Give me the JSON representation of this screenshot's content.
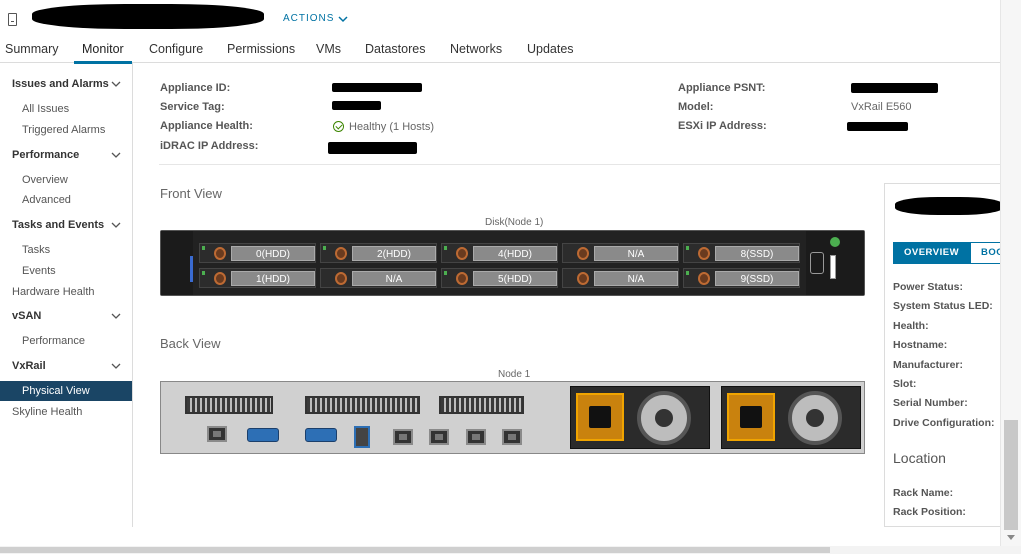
{
  "header": {
    "actions_label": "ACTIONS"
  },
  "tabs": [
    {
      "label": "Summary"
    },
    {
      "label": "Monitor",
      "active": true
    },
    {
      "label": "Configure"
    },
    {
      "label": "Permissions"
    },
    {
      "label": "VMs"
    },
    {
      "label": "Datastores"
    },
    {
      "label": "Networks"
    },
    {
      "label": "Updates"
    }
  ],
  "sidebar": {
    "items": [
      {
        "label": "Issues and Alarms",
        "kind": "group"
      },
      {
        "label": "All Issues",
        "kind": "sub"
      },
      {
        "label": "Triggered Alarms",
        "kind": "sub"
      },
      {
        "label": "Performance",
        "kind": "group"
      },
      {
        "label": "Overview",
        "kind": "sub"
      },
      {
        "label": "Advanced",
        "kind": "sub"
      },
      {
        "label": "Tasks and Events",
        "kind": "group"
      },
      {
        "label": "Tasks",
        "kind": "sub"
      },
      {
        "label": "Events",
        "kind": "sub"
      },
      {
        "label": "Hardware Health",
        "kind": "top"
      },
      {
        "label": "vSAN",
        "kind": "group"
      },
      {
        "label": "Performance",
        "kind": "sub"
      },
      {
        "label": "VxRail",
        "kind": "group"
      },
      {
        "label": "Physical View",
        "kind": "sub",
        "selected": true
      },
      {
        "label": "Skyline Health",
        "kind": "top"
      }
    ]
  },
  "properties": {
    "appliance_id_label": "Appliance ID:",
    "service_tag_label": "Service Tag:",
    "appliance_health_label": "Appliance Health:",
    "appliance_health_value": "Healthy",
    "appliance_health_hosts": "(1 Hosts)",
    "idrac_ip_label": "iDRAC IP Address:",
    "appliance_psnt_label": "Appliance PSNT:",
    "model_label": "Model:",
    "model_value": "VxRail E560",
    "esxi_ip_label": "ESXi IP Address:"
  },
  "front_view": {
    "title": "Front View",
    "caption": "Disk(Node 1)",
    "disks": [
      {
        "label": "0(HDD)"
      },
      {
        "label": "2(HDD)"
      },
      {
        "label": "4(HDD)"
      },
      {
        "label": "N/A"
      },
      {
        "label": "8(SSD)"
      },
      {
        "label": "1(HDD)"
      },
      {
        "label": "N/A"
      },
      {
        "label": "5(HDD)"
      },
      {
        "label": "N/A"
      },
      {
        "label": "9(SSD)"
      }
    ]
  },
  "back_view": {
    "title": "Back View",
    "caption": "Node 1"
  },
  "detail_panel": {
    "tabs": [
      {
        "label": "OVERVIEW",
        "active": true
      },
      {
        "label": "BOOT"
      }
    ],
    "fields": [
      {
        "label": "Power Status:"
      },
      {
        "label": "System Status LED:"
      },
      {
        "label": "Health:"
      },
      {
        "label": "Hostname:"
      },
      {
        "label": "Manufacturer:"
      },
      {
        "label": "Slot:"
      },
      {
        "label": "Serial Number:"
      },
      {
        "label": "Drive Configuration:"
      }
    ],
    "location_title": "Location",
    "location_fields": [
      {
        "label": "Rack Name:"
      },
      {
        "label": "Rack Position:"
      }
    ]
  },
  "colors": {
    "accent": "#0072a3",
    "selected_nav": "#1a4565",
    "health_ok": "#3c8500"
  }
}
